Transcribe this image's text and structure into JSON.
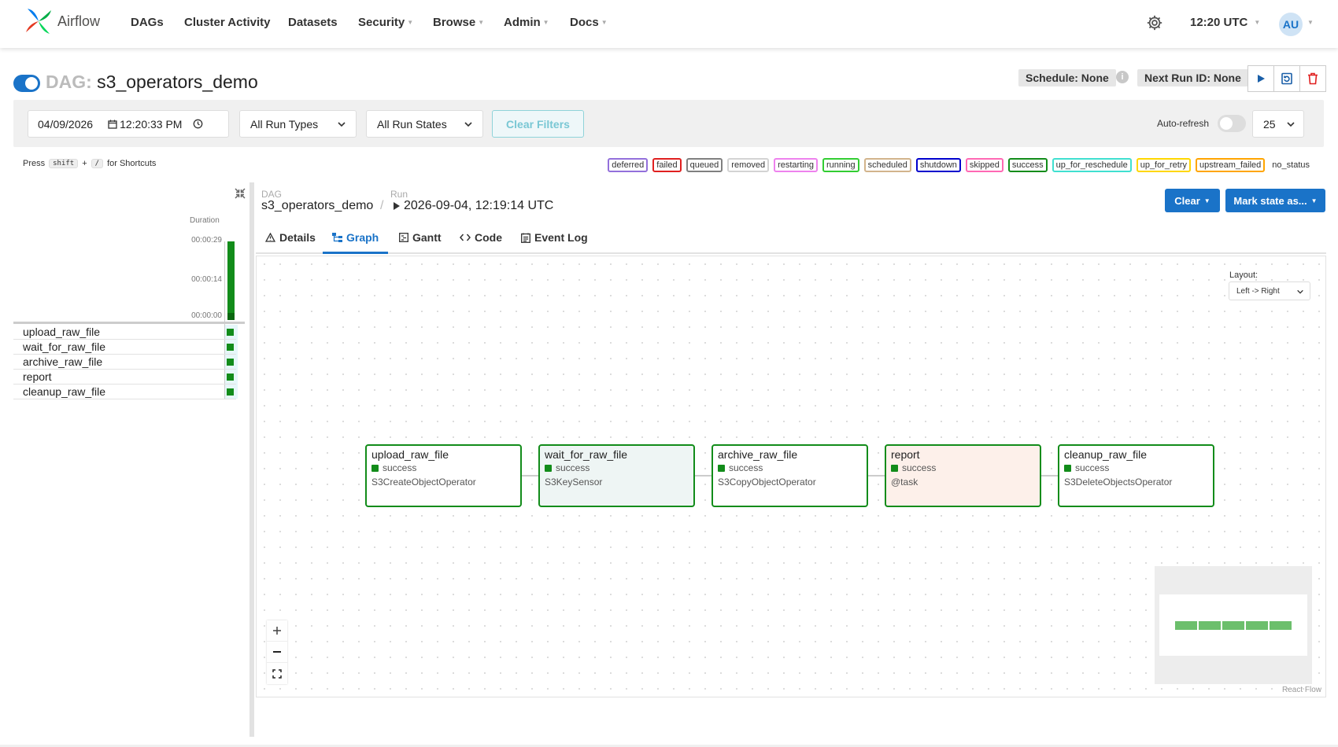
{
  "nav": {
    "brand": "Airflow",
    "items": [
      "DAGs",
      "Cluster Activity",
      "Datasets",
      "Security",
      "Browse",
      "Admin",
      "Docs"
    ],
    "time": "12:20 UTC",
    "avatar": "AU",
    "brand_colors": [
      "#017cee",
      "#00ad46",
      "#e43921",
      "#04d659"
    ]
  },
  "dag": {
    "prefix": "DAG:",
    "id": "s3_operators_demo",
    "schedule": "Schedule: None",
    "next_run": "Next Run ID: None"
  },
  "filters": {
    "date": "04/09/2026",
    "time": "12:20:33 PM",
    "run_types": "All Run Types",
    "run_states": "All Run States",
    "clear": "Clear Filters",
    "auto_refresh": "Auto-refresh",
    "count": "25"
  },
  "shortcuts": {
    "press": "Press",
    "key1": "shift",
    "plus": "+",
    "key2": "/",
    "suffix": "for Shortcuts"
  },
  "legend": [
    {
      "label": "deferred",
      "color": "#9370db"
    },
    {
      "label": "failed",
      "color": "#e02020"
    },
    {
      "label": "queued",
      "color": "#808080"
    },
    {
      "label": "removed",
      "color": "#d3d3d3"
    },
    {
      "label": "restarting",
      "color": "#ee82ee"
    },
    {
      "label": "running",
      "color": "#32cd32"
    },
    {
      "label": "scheduled",
      "color": "#d2b48c"
    },
    {
      "label": "shutdown",
      "color": "#0000cd"
    },
    {
      "label": "skipped",
      "color": "#ff69b4"
    },
    {
      "label": "success",
      "color": "#128c1a"
    },
    {
      "label": "up_for_reschedule",
      "color": "#40e0d0"
    },
    {
      "label": "up_for_retry",
      "color": "#ffd700"
    },
    {
      "label": "upstream_failed",
      "color": "#ffa500"
    },
    {
      "label": "no_status",
      "color": "transparent"
    }
  ],
  "grid": {
    "duration_label": "Duration",
    "ticks": [
      "00:00:29",
      "00:00:14",
      "00:00:00"
    ],
    "tasks": [
      "upload_raw_file",
      "wait_for_raw_file",
      "archive_raw_file",
      "report",
      "cleanup_raw_file"
    ]
  },
  "run": {
    "dag_label": "DAG",
    "run_label": "Run",
    "dag_id": "s3_operators_demo",
    "run_id": "2026-09-04, 12:19:14 UTC",
    "clear": "Clear",
    "mark_state": "Mark state as..."
  },
  "tabs": [
    "Details",
    "Graph",
    "Gantt",
    "Code",
    "Event Log"
  ],
  "graph": {
    "layout_label": "Layout:",
    "layout_value": "Left -> Right",
    "nodes": [
      {
        "name": "upload_raw_file",
        "state": "success",
        "operator": "S3CreateObjectOperator",
        "bg": "#ffffff"
      },
      {
        "name": "wait_for_raw_file",
        "state": "success",
        "operator": "S3KeySensor",
        "bg": "#eef5f4"
      },
      {
        "name": "archive_raw_file",
        "state": "success",
        "operator": "S3CopyObjectOperator",
        "bg": "#ffffff"
      },
      {
        "name": "report",
        "state": "success",
        "operator": "@task",
        "bg": "#fdf0ea"
      },
      {
        "name": "cleanup_raw_file",
        "state": "success",
        "operator": "S3DeleteObjectsOperator",
        "bg": "#ffffff"
      }
    ],
    "attribution": "React Flow"
  }
}
